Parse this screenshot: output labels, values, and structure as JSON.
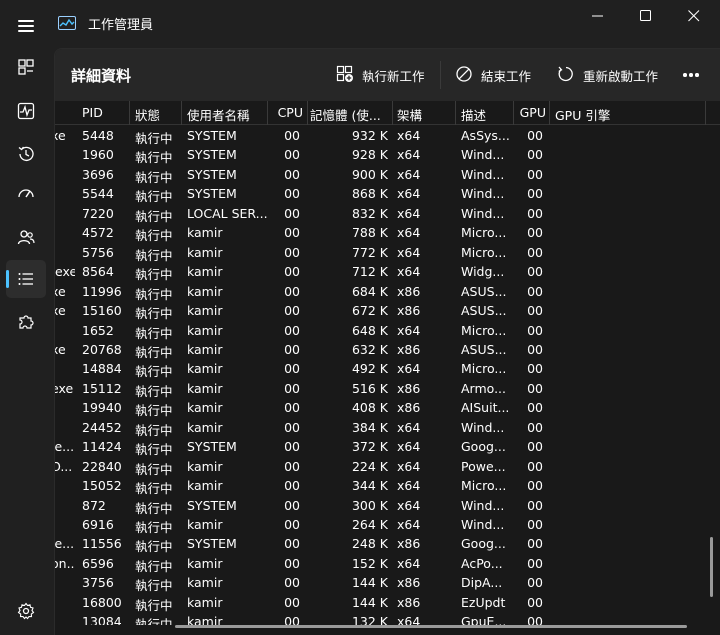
{
  "window": {
    "title": "工作管理員"
  },
  "toolbar": {
    "page_title": "詳細資料",
    "run_new_task": "執行新工作",
    "end_task": "結束工作",
    "restart": "重新啟動工作"
  },
  "columns": [
    "PID",
    "狀態",
    "使用者名稱",
    "CPU",
    "記憶體 (使...",
    "架構",
    "描述",
    "GPU",
    "GPU 引擎"
  ],
  "rows": [
    {
      "name": "xe",
      "pid": "5448",
      "status": "執行中",
      "user": "SYSTEM",
      "cpu": "00",
      "mem": "932 K",
      "arch": "x64",
      "desc": "AsSys...",
      "gpu": "00"
    },
    {
      "name": "",
      "pid": "1960",
      "status": "執行中",
      "user": "SYSTEM",
      "cpu": "00",
      "mem": "928 K",
      "arch": "x64",
      "desc": "Wind...",
      "gpu": "00"
    },
    {
      "name": "",
      "pid": "3696",
      "status": "執行中",
      "user": "SYSTEM",
      "cpu": "00",
      "mem": "900 K",
      "arch": "x64",
      "desc": "Wind...",
      "gpu": "00"
    },
    {
      "name": "",
      "pid": "5544",
      "status": "執行中",
      "user": "SYSTEM",
      "cpu": "00",
      "mem": "868 K",
      "arch": "x64",
      "desc": "Wind...",
      "gpu": "00"
    },
    {
      "name": "",
      "pid": "7220",
      "status": "執行中",
      "user": "LOCAL SER...",
      "cpu": "00",
      "mem": "832 K",
      "arch": "x64",
      "desc": "Wind...",
      "gpu": "00"
    },
    {
      "name": "",
      "pid": "4572",
      "status": "執行中",
      "user": "kamir",
      "cpu": "00",
      "mem": "788 K",
      "arch": "x64",
      "desc": "Micro...",
      "gpu": "00"
    },
    {
      "name": "",
      "pid": "5756",
      "status": "執行中",
      "user": "kamir",
      "cpu": "00",
      "mem": "772 K",
      "arch": "x64",
      "desc": "Micro...",
      "gpu": "00"
    },
    {
      "name": ".exe",
      "pid": "8564",
      "status": "執行中",
      "user": "kamir",
      "cpu": "00",
      "mem": "712 K",
      "arch": "x64",
      "desc": "Widg...",
      "gpu": "00"
    },
    {
      "name": "xe",
      "pid": "11996",
      "status": "執行中",
      "user": "kamir",
      "cpu": "00",
      "mem": "684 K",
      "arch": "x86",
      "desc": "ASUS...",
      "gpu": "00"
    },
    {
      "name": "xe",
      "pid": "15160",
      "status": "執行中",
      "user": "kamir",
      "cpu": "00",
      "mem": "672 K",
      "arch": "x86",
      "desc": "ASUS...",
      "gpu": "00"
    },
    {
      "name": "",
      "pid": "1652",
      "status": "執行中",
      "user": "kamir",
      "cpu": "00",
      "mem": "648 K",
      "arch": "x64",
      "desc": "Micro...",
      "gpu": "00"
    },
    {
      "name": "xe",
      "pid": "20768",
      "status": "執行中",
      "user": "kamir",
      "cpu": "00",
      "mem": "632 K",
      "arch": "x86",
      "desc": "ASUS...",
      "gpu": "00"
    },
    {
      "name": "",
      "pid": "14884",
      "status": "執行中",
      "user": "kamir",
      "cpu": "00",
      "mem": "492 K",
      "arch": "x64",
      "desc": "Micro...",
      "gpu": "00"
    },
    {
      "name": "exe",
      "pid": "15112",
      "status": "執行中",
      "user": "kamir",
      "cpu": "00",
      "mem": "516 K",
      "arch": "x86",
      "desc": "Armo...",
      "gpu": "00"
    },
    {
      "name": "",
      "pid": "19940",
      "status": "執行中",
      "user": "kamir",
      "cpu": "00",
      "mem": "408 K",
      "arch": "x86",
      "desc": "AISuit...",
      "gpu": "00"
    },
    {
      "name": "",
      "pid": "24452",
      "status": "執行中",
      "user": "kamir",
      "cpu": "00",
      "mem": "384 K",
      "arch": "x64",
      "desc": "Wind...",
      "gpu": "00"
    },
    {
      "name": "le...",
      "pid": "11424",
      "status": "執行中",
      "user": "SYSTEM",
      "cpu": "00",
      "mem": "372 K",
      "arch": "x64",
      "desc": "Goog...",
      "gpu": "00"
    },
    {
      "name": "O...",
      "pid": "22840",
      "status": "執行中",
      "user": "kamir",
      "cpu": "00",
      "mem": "224 K",
      "arch": "x64",
      "desc": "Powe...",
      "gpu": "00"
    },
    {
      "name": "",
      "pid": "15052",
      "status": "執行中",
      "user": "kamir",
      "cpu": "00",
      "mem": "344 K",
      "arch": "x64",
      "desc": "Micro...",
      "gpu": "00"
    },
    {
      "name": "",
      "pid": "872",
      "status": "執行中",
      "user": "SYSTEM",
      "cpu": "00",
      "mem": "300 K",
      "arch": "x64",
      "desc": "Wind...",
      "gpu": "00"
    },
    {
      "name": "",
      "pid": "6916",
      "status": "執行中",
      "user": "kamir",
      "cpu": "00",
      "mem": "264 K",
      "arch": "x64",
      "desc": "Wind...",
      "gpu": "00"
    },
    {
      "name": "le...",
      "pid": "11556",
      "status": "執行中",
      "user": "SYSTEM",
      "cpu": "00",
      "mem": "248 K",
      "arch": "x86",
      "desc": "Goog...",
      "gpu": "00"
    },
    {
      "name": "on...",
      "pid": "6596",
      "status": "執行中",
      "user": "kamir",
      "cpu": "00",
      "mem": "152 K",
      "arch": "x64",
      "desc": "AcPo...",
      "gpu": "00"
    },
    {
      "name": "",
      "pid": "3756",
      "status": "執行中",
      "user": "kamir",
      "cpu": "00",
      "mem": "144 K",
      "arch": "x86",
      "desc": "DipA...",
      "gpu": "00"
    },
    {
      "name": "",
      "pid": "16800",
      "status": "執行中",
      "user": "kamir",
      "cpu": "00",
      "mem": "144 K",
      "arch": "x86",
      "desc": "EzUpdt",
      "gpu": "00"
    },
    {
      "name": "",
      "pid": "13084",
      "status": "執行中",
      "user": "kamir",
      "cpu": "00",
      "mem": "132 K",
      "arch": "x64",
      "desc": "GpuE...",
      "gpu": "00"
    }
  ],
  "colors": {
    "bg": "#202020",
    "panel": "#191919",
    "toolbar": "#272727",
    "accent": "#4cc2ff"
  }
}
